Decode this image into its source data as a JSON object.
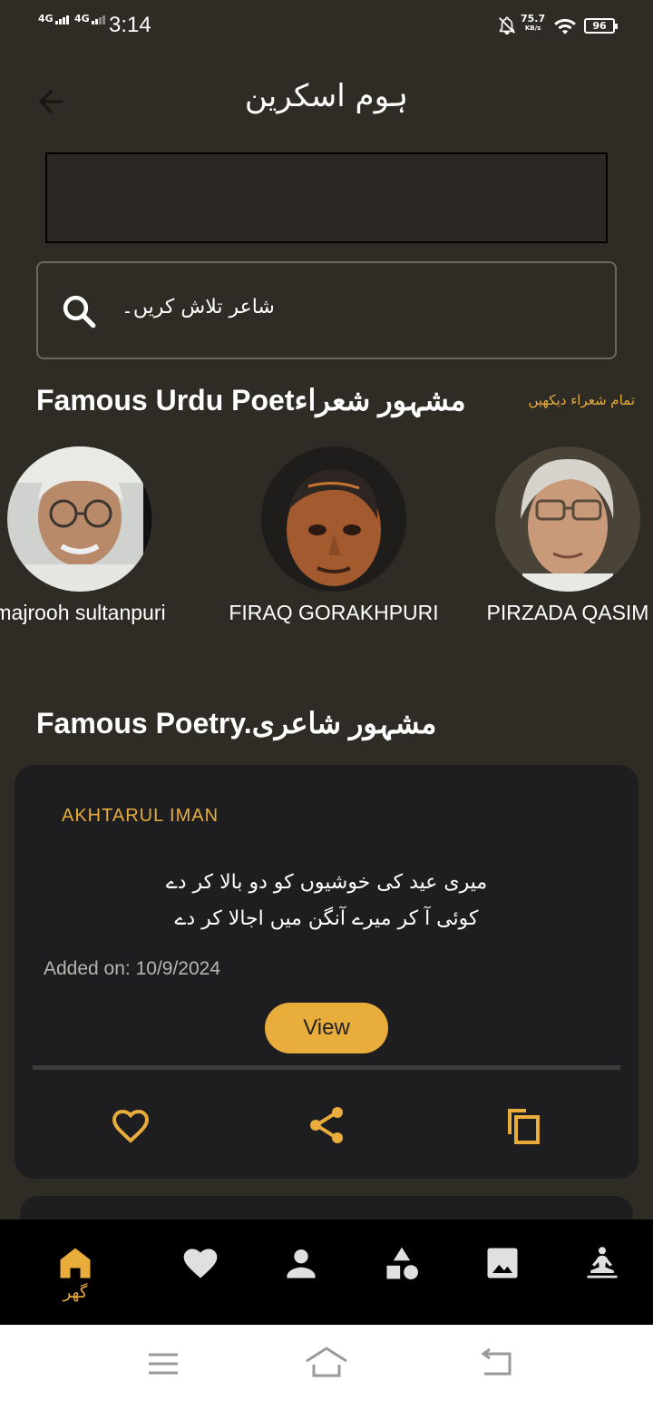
{
  "status_bar": {
    "signal1": "4G",
    "signal2": "4G",
    "time": "3:14",
    "net_speed": "75.7",
    "net_unit": "KB/s",
    "battery": "96"
  },
  "header": {
    "title": "ہوم اسکرین"
  },
  "search": {
    "placeholder": "شاعر تلاش کریں۔"
  },
  "famous_poets": {
    "title": "Famous Urdu Poetمشہور شعراء",
    "see_all": "تمام شعراء دیکھیں",
    "poets": [
      {
        "name": "majrooh sultanpuri"
      },
      {
        "name": "FIRAQ GORAKHPURI"
      },
      {
        "name": "PIRZADA QASIM"
      }
    ]
  },
  "famous_poetry": {
    "title": "Famous Poetry.مشہور شاعری",
    "card": {
      "author": "AKHTARUL IMAN",
      "line1": "میری عید کی خوشیوں کو دو بالا کر دے",
      "line2": "کوئی آ کر میرے آنگن میں اجالا کر دے",
      "added_on": "Added on: 10/9/2024",
      "view_label": "View"
    }
  },
  "bottom_nav": {
    "items": [
      {
        "icon": "home-icon",
        "label": "گھر",
        "active": true
      },
      {
        "icon": "heart-icon",
        "label": ""
      },
      {
        "icon": "person-icon",
        "label": ""
      },
      {
        "icon": "category-icon",
        "label": ""
      },
      {
        "icon": "image-icon",
        "label": ""
      },
      {
        "icon": "meditation-icon",
        "label": ""
      }
    ]
  },
  "colors": {
    "background": "#2f2b25",
    "accent": "#e8ad3b",
    "card": "#1e1e20"
  }
}
